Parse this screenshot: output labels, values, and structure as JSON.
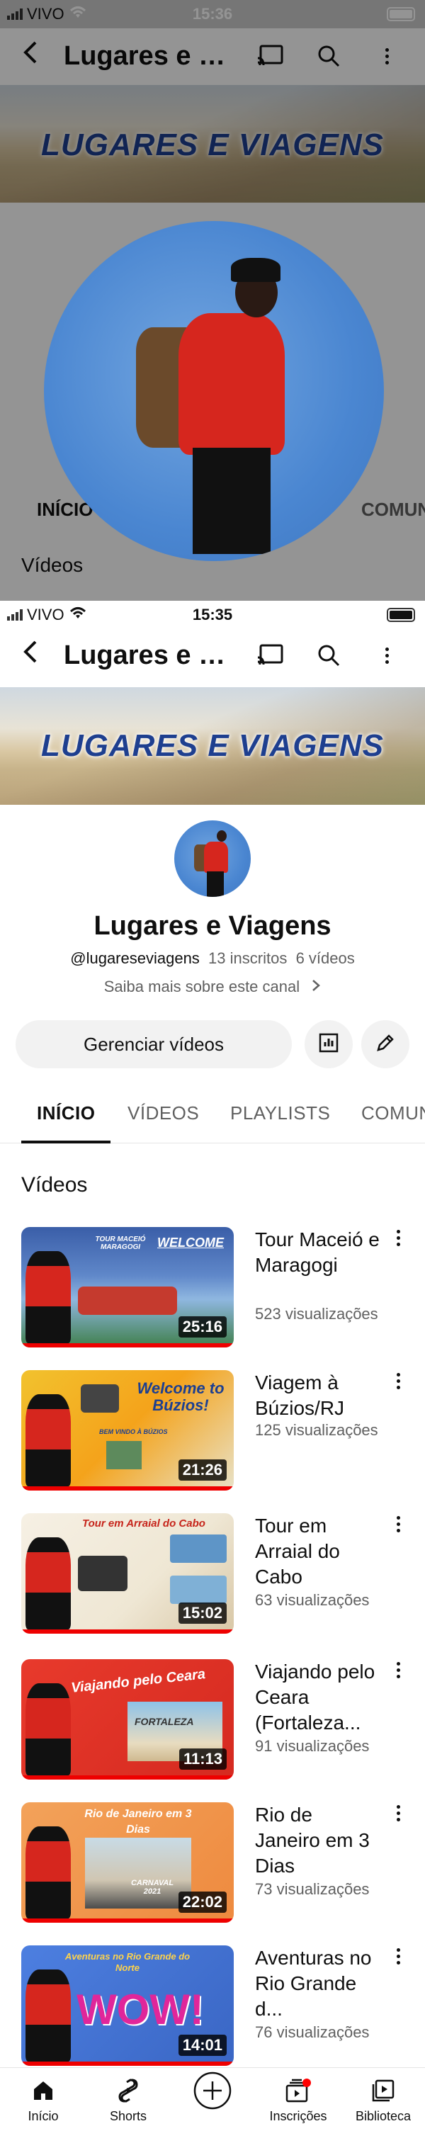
{
  "overlay": {
    "status": {
      "carrier": "VIVO",
      "time": "15:36"
    },
    "header_title": "Lugares e Viagens",
    "banner_text": "LUGARES E VIAGENS",
    "tabs": {
      "start": "INÍCIO",
      "community": "COMUN"
    },
    "section": "Vídeos"
  },
  "status": {
    "carrier": "VIVO",
    "time": "15:35"
  },
  "header": {
    "title": "Lugares e Viagens"
  },
  "banner": {
    "text": "LUGARES E VIAGENS"
  },
  "channel": {
    "name": "Lugares e Viagens",
    "handle": "@lugareseviagens",
    "subscribers": "13 inscritos",
    "video_count": "6 vídeos",
    "more_link": "Saiba mais sobre este canal"
  },
  "actions": {
    "manage_label": "Gerenciar vídeos"
  },
  "tabs": [
    "INÍCIO",
    "VÍDEOS",
    "PLAYLISTS",
    "COMUN"
  ],
  "section_title": "Vídeos",
  "videos": [
    {
      "title": "Tour Maceió e Maragogi",
      "views": "523 visualizações",
      "duration": "25:16",
      "thumb_text": "WELCOME",
      "thumb_subtext": "TOUR MACEIÓ MARAGOGI"
    },
    {
      "title": "Viagem à Búzios/RJ",
      "views": "125 visualizações",
      "duration": "21:26",
      "thumb_text": "Welcome to Búzios!",
      "thumb_subtext": "BEM VINDO À BÚZIOS"
    },
    {
      "title": "Tour em Arraial do Cabo",
      "views": "63 visualizações",
      "duration": "15:02",
      "thumb_text": "Tour em Arraial do Cabo"
    },
    {
      "title": "Viajando pelo Ceara (Fortaleza...",
      "views": "91 visualizações",
      "duration": "11:13",
      "thumb_text": "Viajando pelo Ceara",
      "thumb_subtext": "FORTALEZA"
    },
    {
      "title": "Rio de Janeiro em 3 Dias",
      "views": "73 visualizações",
      "duration": "22:02",
      "thumb_text": "Rio de Janeiro em 3 Dias",
      "thumb_subtext": "CARNAVAL 2021"
    },
    {
      "title": "Aventuras no Rio Grande d...",
      "views": "76 visualizações",
      "duration": "14:01",
      "thumb_text": "Aventuras no Rio Grande do Norte",
      "thumb_subtext": "WOW!"
    }
  ],
  "bottom_nav": [
    "Início",
    "Shorts",
    "",
    "Inscrições",
    "Biblioteca"
  ],
  "colors": {
    "accent_red": "#ff0000",
    "banner_text": "#1e3f8f",
    "sky_blue": "#4a86d1"
  }
}
